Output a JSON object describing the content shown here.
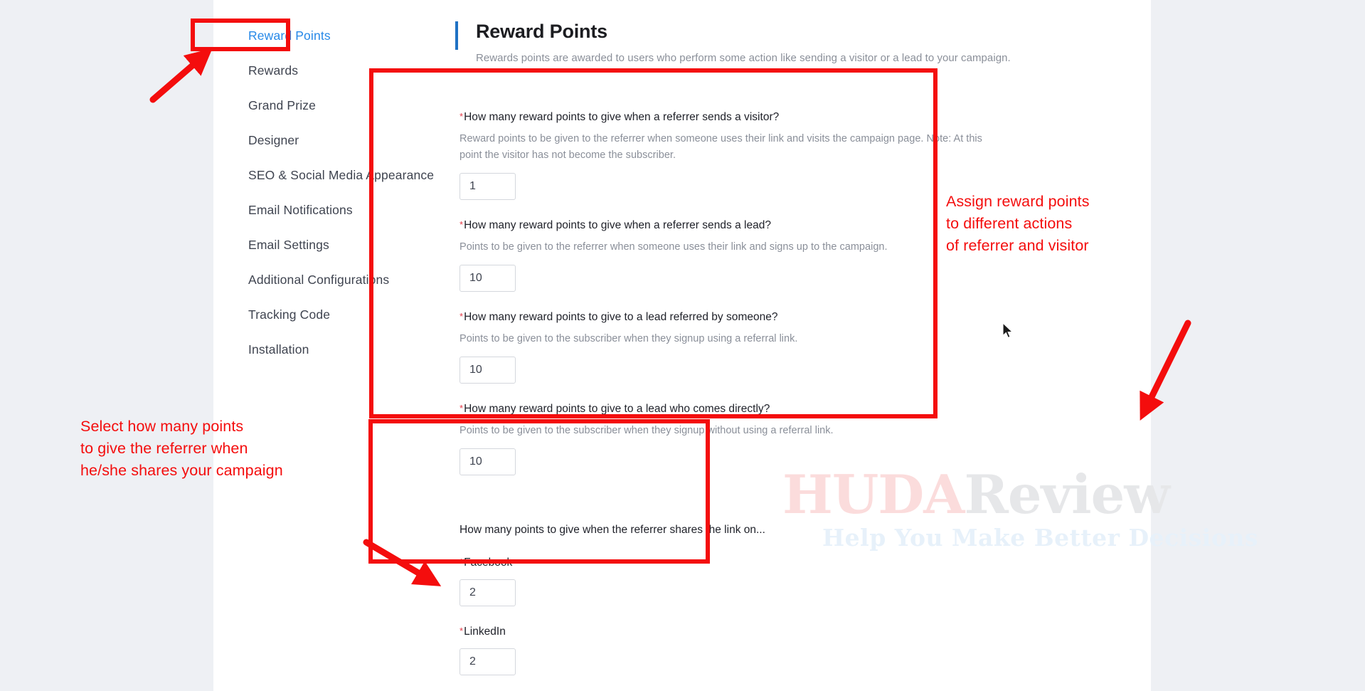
{
  "sidebar": {
    "items": [
      {
        "label": "Reward Points",
        "active": true
      },
      {
        "label": "Rewards",
        "active": false
      },
      {
        "label": "Grand Prize",
        "active": false
      },
      {
        "label": "Designer",
        "active": false
      },
      {
        "label": "SEO & Social Media Appearance",
        "active": false
      },
      {
        "label": "Email Notifications",
        "active": false
      },
      {
        "label": "Email Settings",
        "active": false
      },
      {
        "label": "Additional Configurations",
        "active": false
      },
      {
        "label": "Tracking Code",
        "active": false
      },
      {
        "label": "Installation",
        "active": false
      }
    ]
  },
  "content": {
    "title": "Reward Points",
    "subtitle": "Rewards points are awarded to users who perform some action like sending a visitor or a lead to your campaign.",
    "required_marker": "*",
    "fields": [
      {
        "label": "How many reward points to give when a referrer sends a visitor?",
        "help": "Reward points to be given to the referrer when someone uses their link and visits the campaign page. Note: At this point the visitor has not become the subscriber.",
        "value": "1"
      },
      {
        "label": "How many reward points to give when a referrer sends a lead?",
        "help": "Points to be given to the referrer when someone uses their link and signs up to the campaign.",
        "value": "10"
      },
      {
        "label": "How many reward points to give to a lead referred by someone?",
        "help": "Points to be given to the subscriber when they signup using a referral link.",
        "value": "10"
      },
      {
        "label": "How many reward points to give to a lead who comes directly?",
        "help": "Points to be given to the subscriber when they signup without using a referral link.",
        "value": "10"
      }
    ],
    "share_section": {
      "heading": "How many points to give when the referrer shares the link on...",
      "fields": [
        {
          "label": "Facebook",
          "value": "2"
        },
        {
          "label": "LinkedIn",
          "value": "2"
        }
      ]
    }
  },
  "annotations": {
    "right": "Assign reward points\nto different actions\nof referrer and visitor",
    "left": "Select how many points\nto give the referrer when\nhe/she shares your campaign",
    "color": "#f40d0d"
  },
  "watermark": {
    "brand_primary": "HUDA",
    "brand_secondary": "Review",
    "tagline": "Help You Make Better Decisions"
  },
  "colors": {
    "accent_blue": "#1f72c4",
    "nav_active": "#2688e8",
    "annotation_red": "#f40d0d",
    "page_bg": "#eef0f4",
    "panel_bg": "#ffffff"
  }
}
